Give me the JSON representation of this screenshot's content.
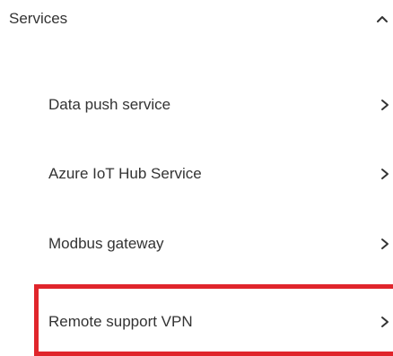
{
  "section": {
    "title": "Services",
    "expanded_icon": "chevron-up-icon"
  },
  "items": [
    {
      "label": "Data push service",
      "icon": "chevron-right-icon"
    },
    {
      "label": "Azure IoT Hub Service",
      "icon": "chevron-right-icon"
    },
    {
      "label": "Modbus gateway",
      "icon": "chevron-right-icon"
    },
    {
      "label": "Remote support VPN",
      "icon": "chevron-right-icon"
    }
  ],
  "colors": {
    "text": "#333333",
    "highlight": "#e0252b",
    "background": "#ffffff"
  }
}
